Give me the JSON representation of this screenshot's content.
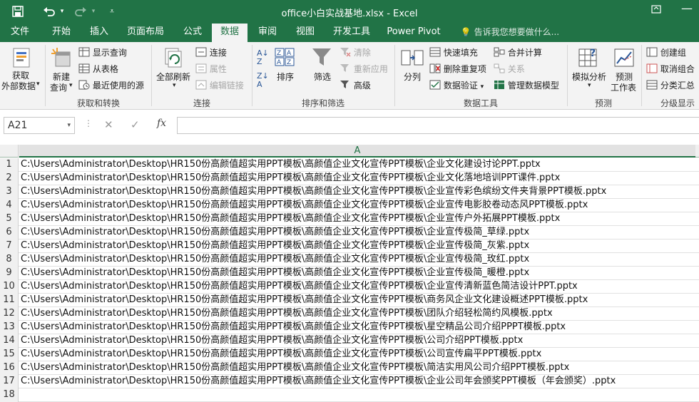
{
  "window": {
    "title": "office小白实战基地.xlsx - Excel",
    "qat": {
      "save_icon": "save-icon",
      "undo_icon": "undo-icon",
      "redo_icon": "redo-icon"
    }
  },
  "tabs": [
    "文件",
    "开始",
    "插入",
    "页面布局",
    "公式",
    "数据",
    "审阅",
    "视图",
    "开发工具",
    "Power Pivot"
  ],
  "tell_me": "告诉我您想要做什么...",
  "ribbon": {
    "get_external": "获取\n外部数据",
    "get_external_l1": "获取",
    "get_external_l2": "外部数据",
    "new_query_l1": "新建",
    "new_query_l2": "查询",
    "show_queries": "显示查询",
    "from_table": "从表格",
    "recent_sources": "最近使用的源",
    "group_get_transform": "获取和转换",
    "refresh_all": "全部刷新",
    "connections": "连接",
    "properties": "属性",
    "edit_links": "编辑链接",
    "group_connections": "连接",
    "sort": "排序",
    "filter": "筛选",
    "clear": "清除",
    "reapply": "重新应用",
    "advanced": "高级",
    "group_sort_filter": "排序和筛选",
    "text_to_columns": "分列",
    "flash_fill": "快速填充",
    "remove_duplicates": "删除重复项",
    "data_validation": "数据验证",
    "consolidate": "合并计算",
    "relationships": "关系",
    "manage_model": "管理数据模型",
    "group_data_tools": "数据工具",
    "what_if": "模拟分析",
    "forecast_l1": "预测",
    "forecast_l2": "工作表",
    "group_forecast": "预测",
    "group": "创建组",
    "ungroup": "取消组合",
    "subtotal": "分类汇总",
    "group_outline": "分级显示"
  },
  "formula_bar": {
    "name_box": "A21",
    "formula": ""
  },
  "sheet": {
    "column_header": "A",
    "rows": [
      {
        "num": "1",
        "value": "C:\\Users\\Administrator\\Desktop\\HR150份高颜值超实用PPT模板\\高颜值企业文化宣传PPT模板\\企业文化建设讨论PPT.pptx"
      },
      {
        "num": "2",
        "value": "C:\\Users\\Administrator\\Desktop\\HR150份高颜值超实用PPT模板\\高颜值企业文化宣传PPT模板\\企业文化落地培训PPT课件.pptx"
      },
      {
        "num": "3",
        "value": "C:\\Users\\Administrator\\Desktop\\HR150份高颜值超实用PPT模板\\高颜值企业文化宣传PPT模板\\企业宣传彩色缤纷文件夹背景PPT模板.pptx"
      },
      {
        "num": "4",
        "value": "C:\\Users\\Administrator\\Desktop\\HR150份高颜值超实用PPT模板\\高颜值企业文化宣传PPT模板\\企业宣传电影胶卷动态风PPT模板.pptx"
      },
      {
        "num": "5",
        "value": "C:\\Users\\Administrator\\Desktop\\HR150份高颜值超实用PPT模板\\高颜值企业文化宣传PPT模板\\企业宣传户外拓展PPT模板.pptx"
      },
      {
        "num": "6",
        "value": "C:\\Users\\Administrator\\Desktop\\HR150份高颜值超实用PPT模板\\高颜值企业文化宣传PPT模板\\企业宣传极简_草绿.pptx"
      },
      {
        "num": "7",
        "value": "C:\\Users\\Administrator\\Desktop\\HR150份高颜值超实用PPT模板\\高颜值企业文化宣传PPT模板\\企业宣传极简_灰紫.pptx"
      },
      {
        "num": "8",
        "value": "C:\\Users\\Administrator\\Desktop\\HR150份高颜值超实用PPT模板\\高颜值企业文化宣传PPT模板\\企业宣传极简_玫红.pptx"
      },
      {
        "num": "9",
        "value": "C:\\Users\\Administrator\\Desktop\\HR150份高颜值超实用PPT模板\\高颜值企业文化宣传PPT模板\\企业宣传极简_暖橙.pptx"
      },
      {
        "num": "10",
        "value": "C:\\Users\\Administrator\\Desktop\\HR150份高颜值超实用PPT模板\\高颜值企业文化宣传PPT模板\\企业宣传清新蓝色简洁设计PPT.pptx"
      },
      {
        "num": "11",
        "value": "C:\\Users\\Administrator\\Desktop\\HR150份高颜值超实用PPT模板\\高颜值企业文化宣传PPT模板\\商务风企业文化建设概述PPT模板.pptx"
      },
      {
        "num": "12",
        "value": "C:\\Users\\Administrator\\Desktop\\HR150份高颜值超实用PPT模板\\高颜值企业文化宣传PPT模板\\团队介绍轻松简约风模板.pptx"
      },
      {
        "num": "13",
        "value": "C:\\Users\\Administrator\\Desktop\\HR150份高颜值超实用PPT模板\\高颜值企业文化宣传PPT模板\\星空精品公司介绍PPPT模板.pptx"
      },
      {
        "num": "14",
        "value": "C:\\Users\\Administrator\\Desktop\\HR150份高颜值超实用PPT模板\\高颜值企业文化宣传PPT模板\\公司介绍PPT模板.pptx"
      },
      {
        "num": "15",
        "value": "C:\\Users\\Administrator\\Desktop\\HR150份高颜值超实用PPT模板\\高颜值企业文化宣传PPT模板\\公司宣传扁平PPT模板.pptx"
      },
      {
        "num": "16",
        "value": "C:\\Users\\Administrator\\Desktop\\HR150份高颜值超实用PPT模板\\高颜值企业文化宣传PPT模板\\简洁实用风公司介绍PPT模板.pptx"
      },
      {
        "num": "17",
        "value": "C:\\Users\\Administrator\\Desktop\\HR150份高颜值超实用PPT模板\\高颜值企业文化宣传PPT模板\\企业公司年会颁奖PPT模板（年会颁奖）.pptx"
      },
      {
        "num": "18",
        "value": ""
      }
    ]
  },
  "colors": {
    "excel_green": "#217346",
    "ribbon_bg": "#f3f3f3"
  }
}
